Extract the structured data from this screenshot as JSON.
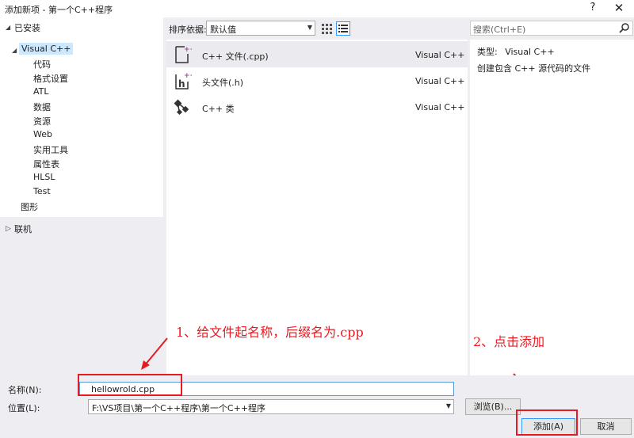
{
  "window": {
    "title": "添加新项 - 第一个C++程序",
    "help": "?",
    "close": "✕"
  },
  "tree": {
    "installed": "已安装",
    "visual_cpp": "Visual C++",
    "children": [
      "代码",
      "格式设置",
      "ATL",
      "数据",
      "资源",
      "Web",
      "实用工具",
      "属性表",
      "HLSL",
      "Test"
    ],
    "graphics": "图形",
    "online": "联机"
  },
  "toolbar": {
    "sort_label": "排序依据:",
    "sort_value": "默认值",
    "search_placeholder": "搜索(Ctrl+E)"
  },
  "templates": [
    {
      "name": "C++ 文件(.cpp)",
      "type": "Visual C++",
      "icon": "cpp-file-icon"
    },
    {
      "name": "头文件(.h)",
      "type": "Visual C++",
      "icon": "header-file-icon"
    },
    {
      "name": "C++ 类",
      "type": "Visual C++",
      "icon": "class-icon"
    }
  ],
  "detail": {
    "type_label": "类型:",
    "type_value": "Visual C++",
    "description": "创建包含 C++ 源代码的文件"
  },
  "annotations": {
    "step1": "1、给文件起名称，后缀名为.cpp",
    "step2": "2、点击添加"
  },
  "form": {
    "name_label": "名称(N):",
    "name_value": "hellowrold.cpp",
    "location_label": "位置(L):",
    "location_value": "F:\\VS项目\\第一个C++程序\\第一个C++程序",
    "browse_label": "浏览(B)...",
    "add_label": "添加(A)",
    "cancel_label": "取消"
  },
  "colors": {
    "annotation": "#e8191f",
    "selection": "#cce8ff",
    "focus": "#3399ff",
    "icon_accent": "#9b4f96"
  }
}
